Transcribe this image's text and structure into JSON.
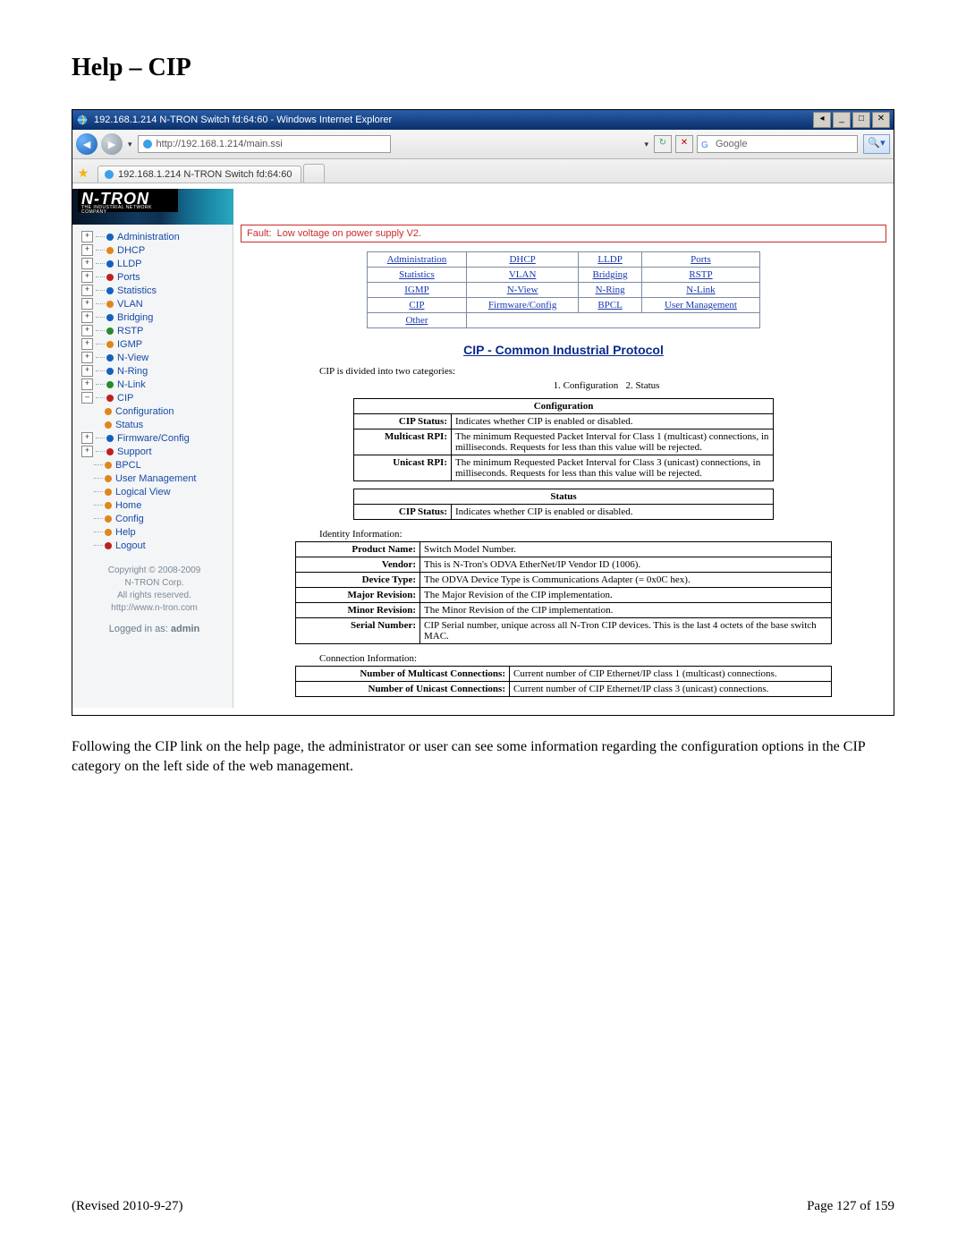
{
  "doc": {
    "title": "Help – CIP",
    "caption": "Following the CIP link on the help page, the administrator or user can see some information regarding the configuration options in the CIP category on the left side of the web management.",
    "revised": "(Revised 2010-9-27)",
    "page": "Page 127 of 159"
  },
  "browser": {
    "window_title": "192.168.1.214 N-TRON Switch fd:64:60 - Windows Internet Explorer",
    "address": "http://192.168.1.214/main.ssi",
    "tab_label": "192.168.1.214 N-TRON Switch fd:64:60",
    "search_placeholder": "Google"
  },
  "app": {
    "logo_text": "N-TRON",
    "logo_subtext": "THE INDUSTRIAL NETWORK COMPANY"
  },
  "sidebar": {
    "items": [
      {
        "label": "Administration",
        "expander": "+",
        "level": 0,
        "bullet": "b-blue"
      },
      {
        "label": "DHCP",
        "expander": "+",
        "level": 0,
        "bullet": "b-orange"
      },
      {
        "label": "LLDP",
        "expander": "+",
        "level": 0,
        "bullet": "b-blue"
      },
      {
        "label": "Ports",
        "expander": "+",
        "level": 0,
        "bullet": "b-red"
      },
      {
        "label": "Statistics",
        "expander": "+",
        "level": 0,
        "bullet": "b-blue"
      },
      {
        "label": "VLAN",
        "expander": "+",
        "level": 0,
        "bullet": "b-orange"
      },
      {
        "label": "Bridging",
        "expander": "+",
        "level": 0,
        "bullet": "b-blue"
      },
      {
        "label": "RSTP",
        "expander": "+",
        "level": 0,
        "bullet": "b-green"
      },
      {
        "label": "IGMP",
        "expander": "+",
        "level": 0,
        "bullet": "b-orange"
      },
      {
        "label": "N-View",
        "expander": "+",
        "level": 0,
        "bullet": "b-blue"
      },
      {
        "label": "N-Ring",
        "expander": "+",
        "level": 0,
        "bullet": "b-blue"
      },
      {
        "label": "N-Link",
        "expander": "+",
        "level": 0,
        "bullet": "b-green"
      },
      {
        "label": "CIP",
        "expander": "–",
        "level": 0,
        "bullet": "b-red"
      },
      {
        "label": "Configuration",
        "expander": "",
        "level": 1,
        "bullet": "b-orange"
      },
      {
        "label": "Status",
        "expander": "",
        "level": 1,
        "bullet": "b-orange"
      },
      {
        "label": "Firmware/Config",
        "expander": "+",
        "level": 0,
        "bullet": "b-blue"
      },
      {
        "label": "Support",
        "expander": "+",
        "level": 0,
        "bullet": "b-red"
      },
      {
        "label": "BPCL",
        "expander": "",
        "level": 0,
        "bullet": "b-orange",
        "noexp": true
      },
      {
        "label": "User Management",
        "expander": "",
        "level": 0,
        "bullet": "b-orange",
        "noexp": true
      },
      {
        "label": "Logical View",
        "expander": "",
        "level": 0,
        "bullet": "b-orange",
        "noexp": true
      },
      {
        "label": "Home",
        "expander": "",
        "level": 0,
        "bullet": "b-orange",
        "noexp": true
      },
      {
        "label": "Config",
        "expander": "",
        "level": 0,
        "bullet": "b-orange",
        "noexp": true
      },
      {
        "label": "Help",
        "expander": "",
        "level": 0,
        "bullet": "b-orange",
        "noexp": true
      },
      {
        "label": "Logout",
        "expander": "",
        "level": 0,
        "bullet": "b-red",
        "noexp": true
      }
    ],
    "footer": {
      "copyright": "Copyright © 2008-2009",
      "company": "N-TRON Corp.",
      "rights": "All rights reserved.",
      "url": "http://www.n-tron.com"
    },
    "login_prefix": "Logged in as:",
    "login_user": "admin"
  },
  "content": {
    "fault_label": "Fault:",
    "fault_text": "Low voltage on power supply V2.",
    "linkgrid": [
      [
        "Administration",
        "DHCP",
        "LLDP",
        "Ports"
      ],
      [
        "Statistics",
        "VLAN",
        "Bridging",
        "RSTP"
      ],
      [
        "IGMP",
        "N-View",
        "N-Ring",
        "N-Link"
      ],
      [
        "CIP",
        "Firmware/Config",
        "BPCL",
        "User Management"
      ],
      [
        "Other",
        "",
        "",
        ""
      ]
    ],
    "cip_title": "CIP - Common Industrial Protocol",
    "cip_intro": "CIP is divided into two categories:",
    "cip_categories": [
      "1. Configuration",
      "2. Status"
    ],
    "configuration": {
      "header": "Configuration",
      "rows": [
        {
          "k": "CIP Status:",
          "v": "Indicates whether CIP is enabled or disabled."
        },
        {
          "k": "Multicast RPI:",
          "v": "The minimum Requested Packet Interval for Class 1 (multicast) connections, in milliseconds. Requests for less than this value will be rejected."
        },
        {
          "k": "Unicast RPI:",
          "v": "The minimum Requested Packet Interval for Class 3 (unicast) connections, in milliseconds. Requests for less than this value will be rejected."
        }
      ]
    },
    "status": {
      "header": "Status",
      "rows": [
        {
          "k": "CIP Status:",
          "v": "Indicates whether CIP is enabled or disabled."
        }
      ]
    },
    "identity_label": "Identity Information:",
    "identity_rows": [
      {
        "k": "Product Name:",
        "v": "Switch Model Number."
      },
      {
        "k": "Vendor:",
        "v": "This is N-Tron's ODVA EtherNet/IP Vendor ID (1006)."
      },
      {
        "k": "Device Type:",
        "v": "The ODVA Device Type is Communications Adapter (= 0x0C hex)."
      },
      {
        "k": "Major Revision:",
        "v": "The Major Revision of the CIP implementation."
      },
      {
        "k": "Minor Revision:",
        "v": "The Minor Revision of the CIP implementation."
      },
      {
        "k": "Serial Number:",
        "v": "CIP Serial number, unique across all N-Tron CIP devices. This is the last 4 octets of the base switch MAC."
      }
    ],
    "connection_label": "Connection Information:",
    "connection_rows": [
      {
        "k": "Number of Multicast Connections:",
        "v": "Current number of CIP Ethernet/IP class 1 (multicast) connections."
      },
      {
        "k": "Number of Unicast Connections:",
        "v": "Current number of CIP Ethernet/IP class 3 (unicast) connections."
      }
    ]
  }
}
